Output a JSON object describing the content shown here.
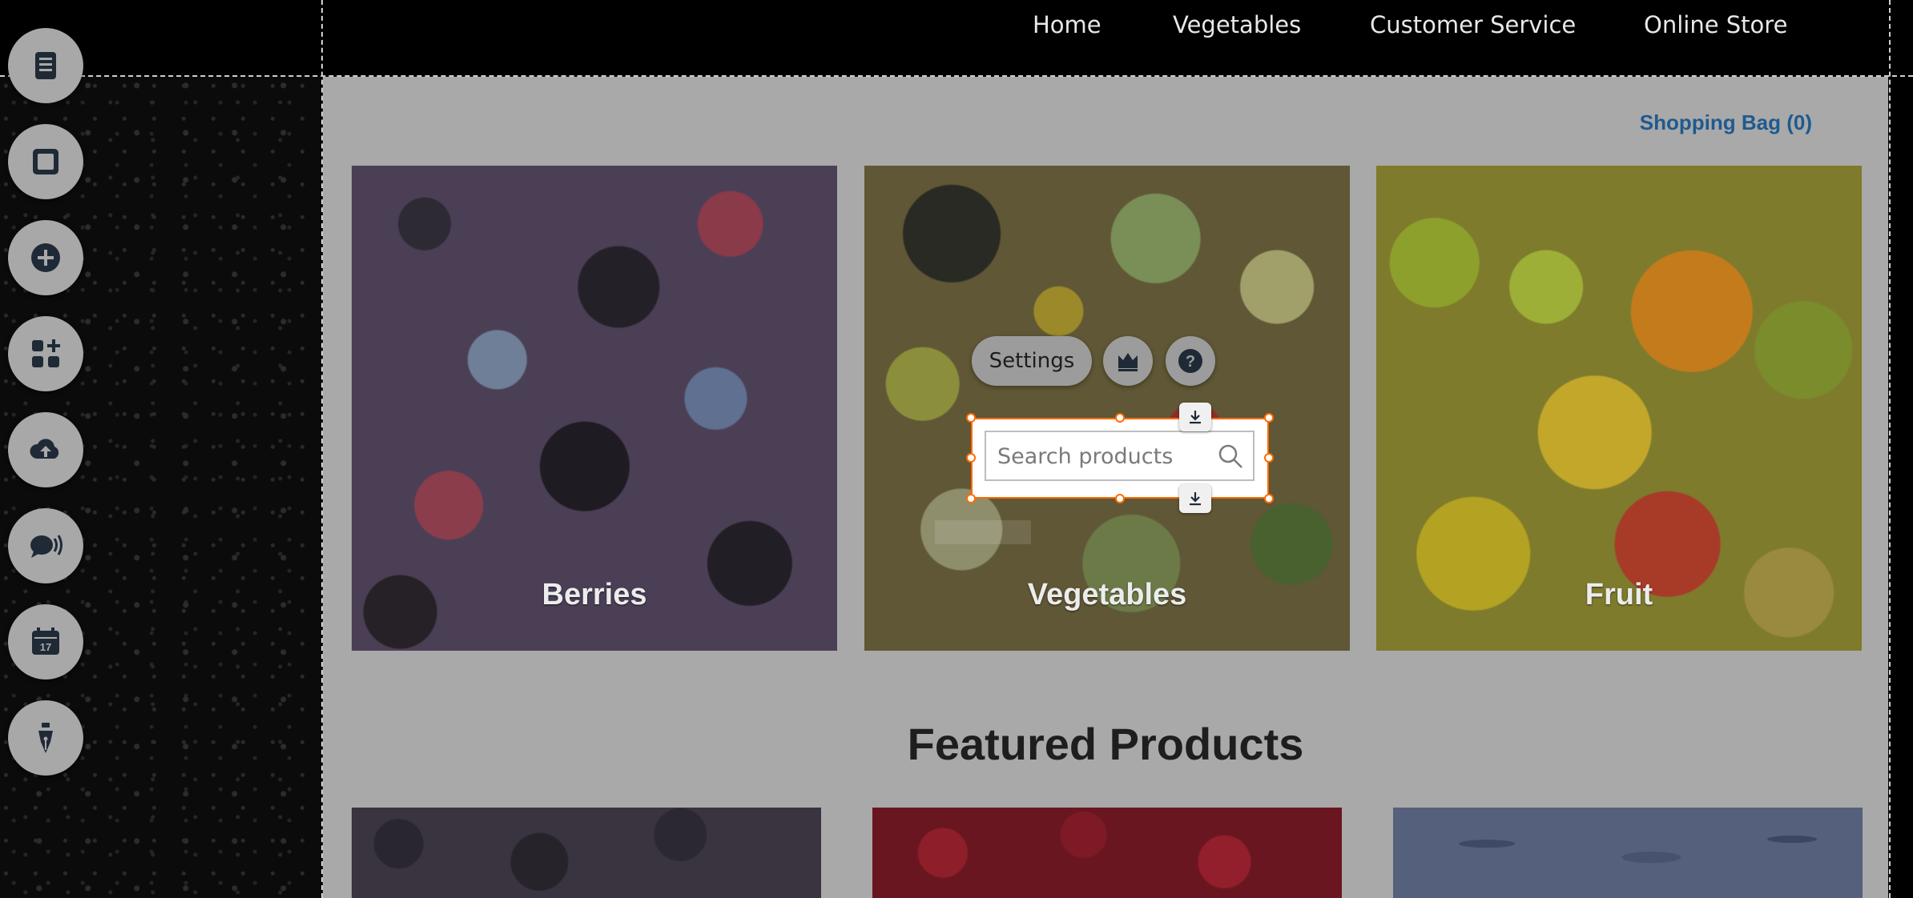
{
  "nav": {
    "items": [
      "Home",
      "Vegetables",
      "Customer Service",
      "Online Store"
    ]
  },
  "cart": {
    "label": "Shopping Bag (0)"
  },
  "categories": [
    {
      "label": "Berries"
    },
    {
      "label": "Vegetables"
    },
    {
      "label": "Fruit"
    }
  ],
  "featured": {
    "title": "Featured Products"
  },
  "toolbar": {
    "tools": [
      "pages-icon",
      "box-icon",
      "add-icon",
      "apps-icon",
      "upload-cloud-icon",
      "chat-icon",
      "calendar-icon",
      "pen-nib-icon"
    ],
    "calendar_day": "17"
  },
  "editor": {
    "settings_label": "Settings",
    "search_placeholder": "Search products",
    "selection_color": "#ff6a00"
  }
}
